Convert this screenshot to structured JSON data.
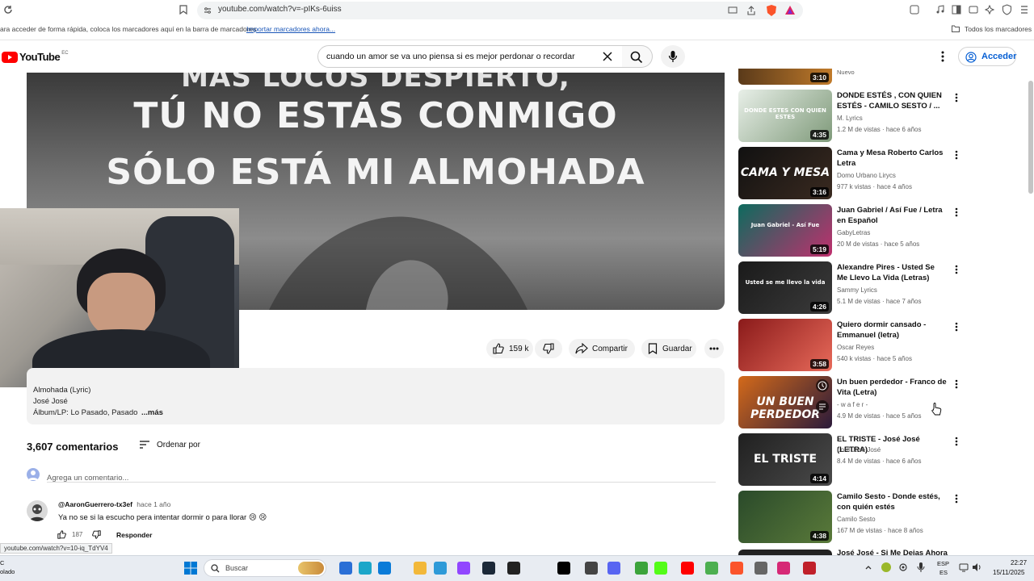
{
  "browser": {
    "url": "youtube.com/watch?v=-pIKs-6uiss",
    "bookmarks_hint": "ara acceder de forma rápida, coloca los marcadores aquí en la barra de marcadores",
    "import_link": "Importar marcadores ahora...",
    "all_bookmarks": "Todos los marcadores",
    "status_url": "youtube.com/watch?v=10-iq_TdYV4"
  },
  "youtube": {
    "logo_text": "YouTube",
    "region": "EC",
    "search_value": "cuando un amor se va uno piensa si es mejor perdonar o recordar",
    "login": "Acceder"
  },
  "player": {
    "lyric_top": "MÁS LOCOS DESPIERTO,",
    "lyric_1": "TÚ NO ESTÁS CONMIGO",
    "lyric_2": "SÓLO ESTÁ MI ALMOHADA"
  },
  "actions": {
    "likes": "159 k",
    "share": "Compartir",
    "save": "Guardar"
  },
  "description": {
    "line1": "Almohada (Lyric)",
    "line2": "José José",
    "line3": "Álbum/LP: Lo Pasado, Pasado",
    "more": "...más"
  },
  "comments": {
    "count": "3,607 comentarios",
    "sort": "Ordenar por",
    "add_placeholder": "Agrega un comentario...",
    "items": [
      {
        "author": "@AaronGuerrero-tx3ef",
        "time": "hace 1 año",
        "text": "Ya no se si la escucho pera intentar dormir o para llorar 😢 😢",
        "likes": "187",
        "reply": "Responder"
      }
    ]
  },
  "sidebar": {
    "partial_top": {
      "duration": "3:10",
      "meta": "Nuevo"
    },
    "videos": [
      {
        "title": "DONDE ESTÉS , CON QUIEN ESTÉS - CAMILO SESTO / ...",
        "channel": "M. Lyrics",
        "meta": "1.2 M de vistas · hace 6 años",
        "duration": "4:35",
        "thumb_text": "DONDE ESTES CON QUIEN ESTES",
        "color1": "#e8efe8",
        "color2": "#7f9a7a"
      },
      {
        "title": "Cama y Mesa Roberto Carlos Letra",
        "channel": "Domo Urbano Lirycs",
        "meta": "977 k vistas · hace 4 años",
        "duration": "3:16",
        "thumb_text": "CAMA Y MESA",
        "color1": "#111111",
        "color2": "#3a2a20"
      },
      {
        "title": "Juan Gabriel / Así Fue / Letra en Español",
        "channel": "GabyLetras",
        "meta": "20 M de vistas · hace 5 años",
        "duration": "5:19",
        "thumb_text": "Juan Gabriel - Así Fue",
        "color1": "#0d6b5e",
        "color2": "#c0306e"
      },
      {
        "title": "Alexandre Pires - Usted Se Me Llevo La Vida (Letras)",
        "channel": "Sammy Lyrics",
        "meta": "5.1 M de vistas · hace 7 años",
        "duration": "4:26",
        "thumb_text": "Usted se me llevo la vida",
        "color1": "#1a1a1a",
        "color2": "#3b3b3b"
      },
      {
        "title": "Quiero dormir cansado - Emmanuel (letra)",
        "channel": "Oscar Reyes",
        "meta": "540 k vistas · hace 5 años",
        "duration": "3:58",
        "thumb_text": "",
        "color1": "#8a1a1a",
        "color2": "#e86a5a"
      },
      {
        "title": "Un buen perdedor - Franco de Vita (Letra)",
        "channel": "- w a f e r -",
        "meta": "4.9 M de vistas · hace 5 años",
        "duration": "",
        "thumb_text": "UN BUEN PERDEDOR",
        "color1": "#d46a1a",
        "color2": "#2a1a3a"
      },
      {
        "title": "EL TRISTE - José José (LETRA)",
        "channel": "Lord José José",
        "meta": "8.4 M de vistas · hace 6 años",
        "duration": "4:14",
        "thumb_text": "EL TRISTE",
        "color1": "#202020",
        "color2": "#4a4a4a"
      },
      {
        "title": "Camilo Sesto - Donde estés, con quién estés",
        "channel": "Camilo Sesto",
        "meta": "167 M de vistas · hace 8 años",
        "duration": "4:38",
        "thumb_text": "",
        "color1": "#2a4a2a",
        "color2": "#5a7a3a"
      }
    ],
    "partial_bottom_title": "José José - Si Me Dejas Ahora"
  },
  "taskbar": {
    "search_placeholder": "Buscar",
    "lang1": "ESP",
    "lang2": "ES",
    "time": "22:27",
    "date": "15/11/2025",
    "left_status1": "C",
    "left_status2": "olado"
  }
}
